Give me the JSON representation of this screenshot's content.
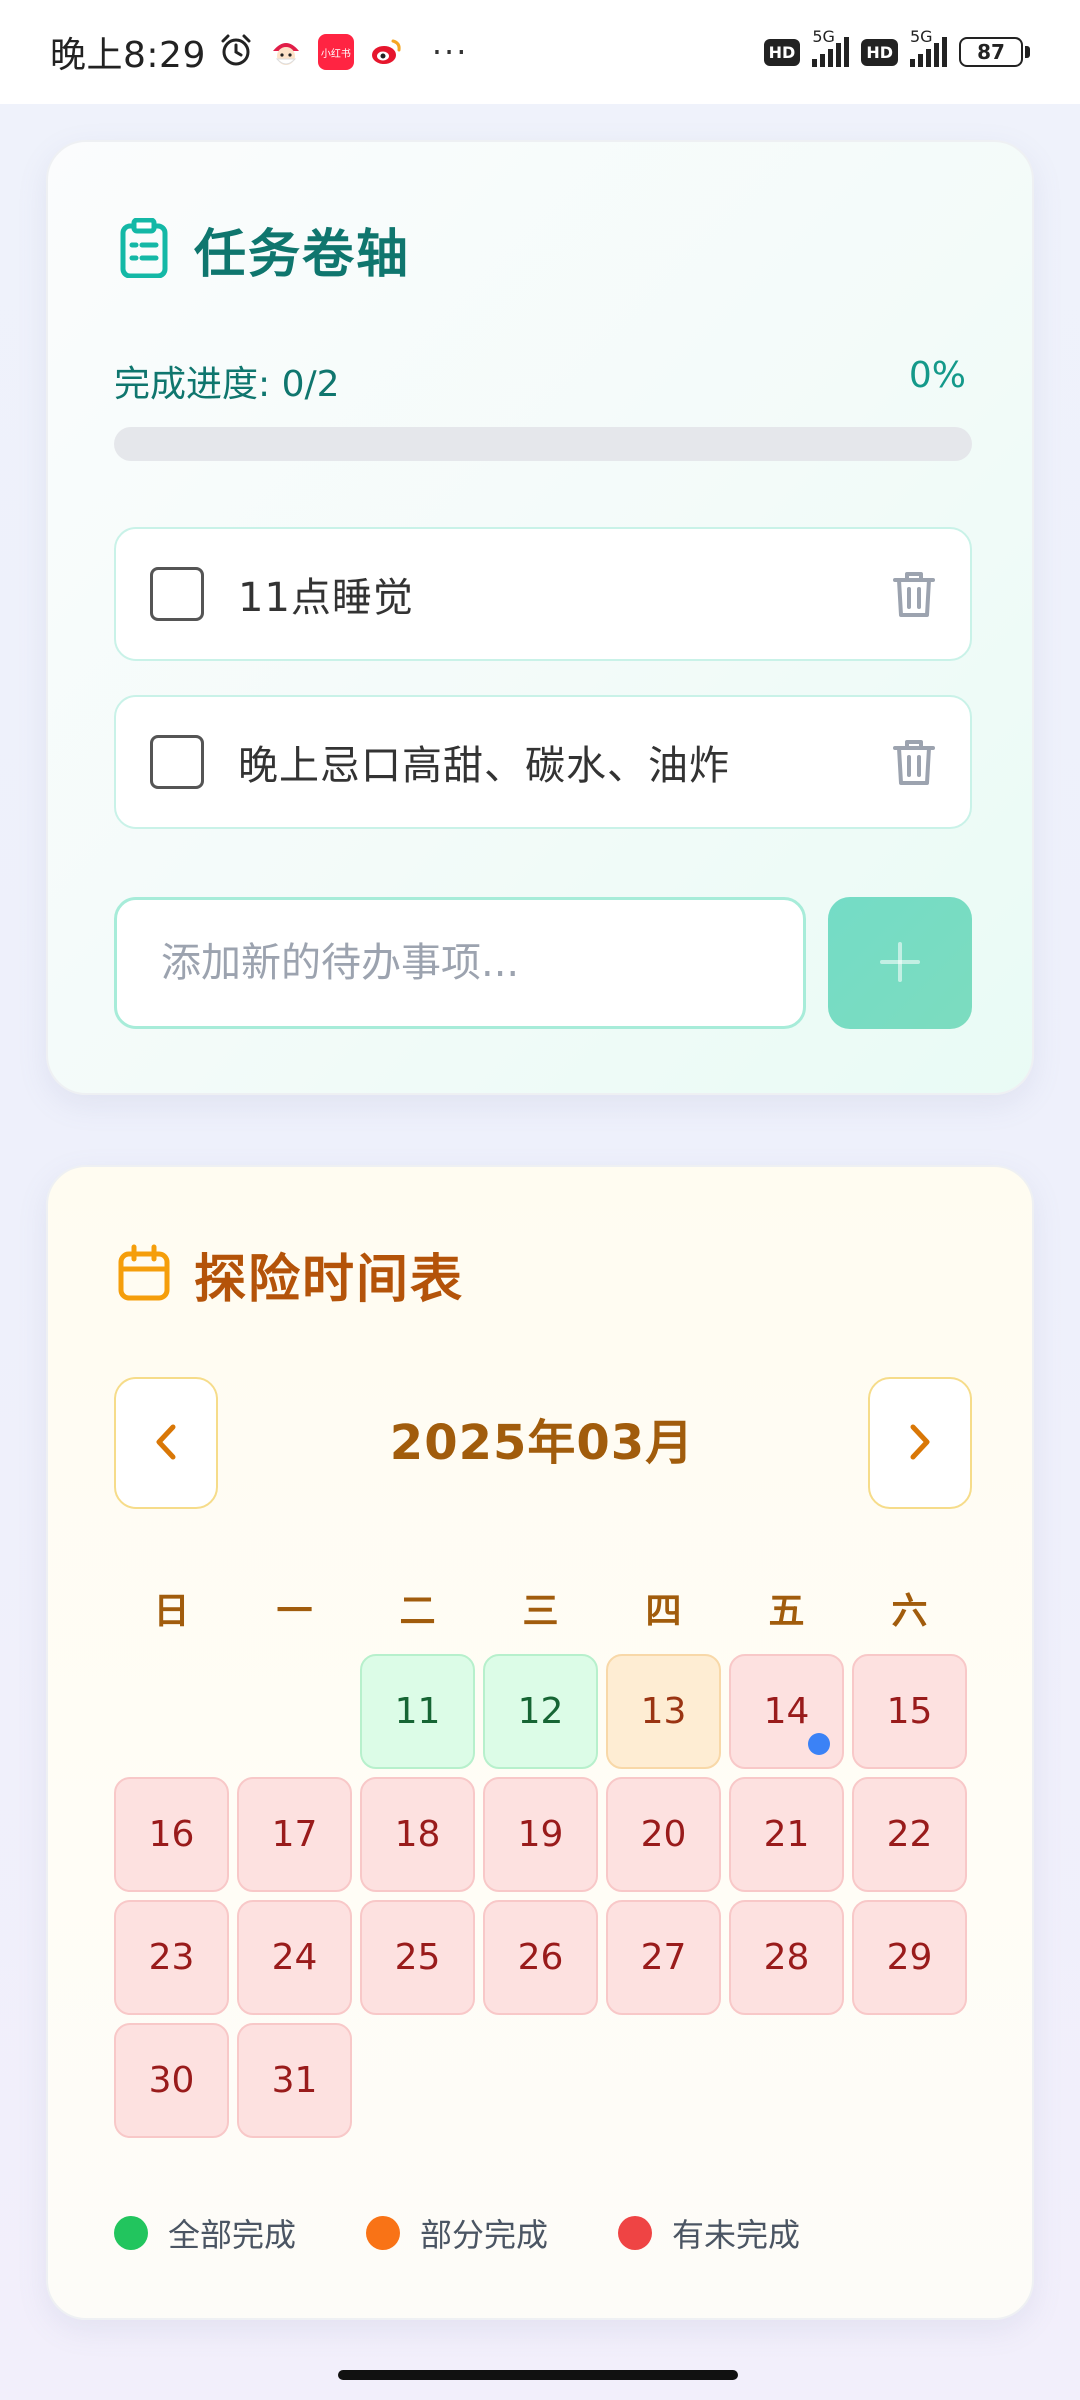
{
  "status_bar": {
    "time": "晚上8:29",
    "dots": "···",
    "hd1": "HD",
    "hd2": "HD",
    "net1": "5G",
    "net2": "5G",
    "battery": "87"
  },
  "task_card": {
    "title": "任务卷轴",
    "progress_label": "完成进度: 0/2",
    "progress_percent": "0%",
    "progress_value": 0,
    "todos": [
      {
        "text": "11点睡觉",
        "done": false
      },
      {
        "text": "晚上忌口高甜、碳水、油炸",
        "done": false
      }
    ],
    "input_placeholder": "添加新的待办事项...",
    "colors": {
      "accent": "#0f766e",
      "button": "#74dcc6"
    }
  },
  "calendar_card": {
    "title": "探险时间表",
    "month_label": "2025年03月",
    "weekdays": [
      "日",
      "一",
      "二",
      "三",
      "四",
      "五",
      "六"
    ],
    "days": [
      {
        "day": ""
      },
      {
        "day": ""
      },
      {
        "day": "11",
        "status": "full"
      },
      {
        "day": "12",
        "status": "full"
      },
      {
        "day": "13",
        "status": "partial"
      },
      {
        "day": "14",
        "status": "incomplete",
        "today": true
      },
      {
        "day": "15",
        "status": "incomplete"
      },
      {
        "day": "16",
        "status": "incomplete"
      },
      {
        "day": "17",
        "status": "incomplete"
      },
      {
        "day": "18",
        "status": "incomplete"
      },
      {
        "day": "19",
        "status": "incomplete"
      },
      {
        "day": "20",
        "status": "incomplete"
      },
      {
        "day": "21",
        "status": "incomplete"
      },
      {
        "day": "22",
        "status": "incomplete"
      },
      {
        "day": "23",
        "status": "incomplete"
      },
      {
        "day": "24",
        "status": "incomplete"
      },
      {
        "day": "25",
        "status": "incomplete"
      },
      {
        "day": "26",
        "status": "incomplete"
      },
      {
        "day": "27",
        "status": "incomplete"
      },
      {
        "day": "28",
        "status": "incomplete"
      },
      {
        "day": "29",
        "status": "incomplete"
      },
      {
        "day": "30",
        "status": "incomplete"
      },
      {
        "day": "31",
        "status": "incomplete"
      }
    ],
    "legend": [
      {
        "label": "全部完成",
        "color": "#22c55e"
      },
      {
        "label": "部分完成",
        "color": "#f97316"
      },
      {
        "label": "有未完成",
        "color": "#ef4444"
      }
    ],
    "colors": {
      "accent": "#b45309",
      "today_dot": "#3b82f6"
    }
  }
}
